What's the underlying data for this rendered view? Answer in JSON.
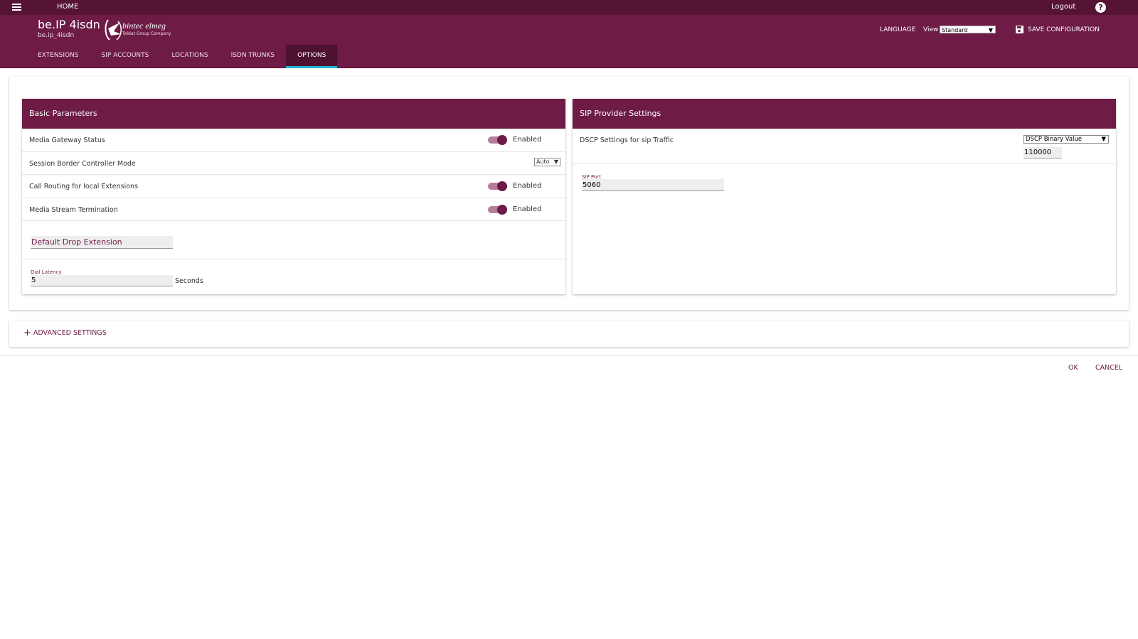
{
  "topbar": {
    "home_label": "HOME",
    "logout_label": "Logout",
    "help_glyph": "?"
  },
  "header": {
    "device_name": "be.IP 4isdn",
    "device_subtitle": "be.ip_4isdn",
    "logo_text": "bintec elmeg",
    "logo_subtext": "Teldat Group Company",
    "language_label": "LANGUAGE",
    "view_label": "View",
    "view_value": "Standard",
    "save_label": "SAVE CONFIGURATION"
  },
  "tabs": [
    {
      "label": "EXTENSIONS"
    },
    {
      "label": "SIP ACCOUNTS"
    },
    {
      "label": "LOCATIONS"
    },
    {
      "label": "ISDN TRUNKS"
    },
    {
      "label": "OPTIONS"
    }
  ],
  "basic": {
    "title": "Basic Parameters",
    "media_gateway_label": "Media Gateway Status",
    "media_gateway_value": "Enabled",
    "sbc_label": "Session Border Controller Mode",
    "sbc_value": "Auto",
    "call_routing_label": "Call Routing for local Extensions",
    "call_routing_value": "Enabled",
    "media_stream_label": "Media Stream Termination",
    "media_stream_value": "Enabled",
    "default_drop_placeholder": "Default Drop Extension",
    "dial_latency_label": "Dial Latency",
    "dial_latency_value": "5",
    "dial_latency_unit": "Seconds"
  },
  "sip": {
    "title": "SIP Provider Settings",
    "dscp_label": "DSCP Settings for sip Traffic",
    "dscp_mode": "DSCP Binary Value",
    "dscp_value": "110000",
    "sip_port_label": "SIP Port",
    "sip_port_value": "5060"
  },
  "advanced": {
    "plus_glyph": "+",
    "label": "ADVANCED SETTINGS"
  },
  "actions": {
    "ok_label": "OK",
    "cancel_label": "CANCEL"
  },
  "colors": {
    "topbar": "#561434",
    "header": "#6e1b46",
    "tab_active_underline": "#20b6d6"
  },
  "icons": {
    "menu": "hamburger-icon",
    "help": "help-icon",
    "save": "save-icon",
    "plus": "plus-icon"
  }
}
